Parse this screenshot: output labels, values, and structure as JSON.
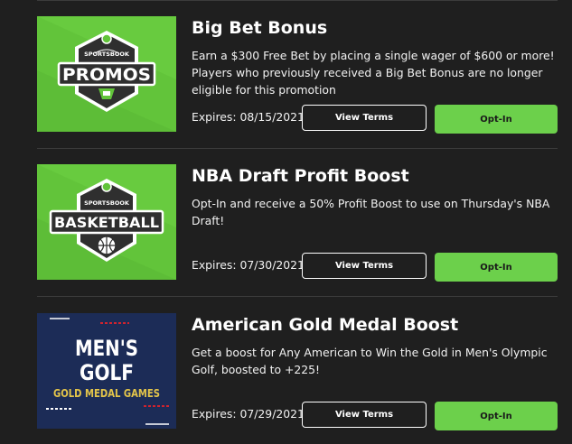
{
  "colors": {
    "background": "#1f1f1f",
    "divider": "#3c3c3c",
    "opt_in_green": "#6cd04b",
    "promo_tile_green": "#62c43a",
    "golf_tile_navy": "#1c2c57",
    "gold_text": "#e4c54a",
    "red_accent": "#d0232e"
  },
  "promotions": [
    {
      "title": "Big Bet Bonus",
      "description": "Earn a $300 Free Bet by placing a single wager of $600 or more! Players who previously received a Big Bet Bonus are no longer eligible for this promotion",
      "expires": "Expires: 08/15/2021",
      "terms_label": "View Terms",
      "optin_label": "Opt-In",
      "image": {
        "icon": "sportsbook-promos-logo",
        "top_text": "SPORTSBOOK",
        "main_text": "PROMOS"
      }
    },
    {
      "title": "NBA Draft Profit Boost",
      "description": "Opt-In and receive a 50% Profit Boost to use on Thursday's NBA Draft!",
      "expires": "Expires: 07/30/2021",
      "terms_label": "View Terms",
      "optin_label": "Opt-In",
      "image": {
        "icon": "sportsbook-basketball-logo",
        "top_text": "SPORTSBOOK",
        "main_text": "BASKETBALL"
      }
    },
    {
      "title": "American Gold Medal Boost",
      "description": "Get a boost for Any American to Win the Gold in Men's Olympic Golf, boosted to +225!",
      "expires": "Expires: 07/29/2021",
      "terms_label": "View Terms",
      "optin_label": "Opt-In",
      "image": {
        "icon": "mens-golf-gold-medal-games-graphic",
        "line1": "MEN'S",
        "line2": "GOLF",
        "line3": "GOLD MEDAL GAMES"
      }
    }
  ]
}
